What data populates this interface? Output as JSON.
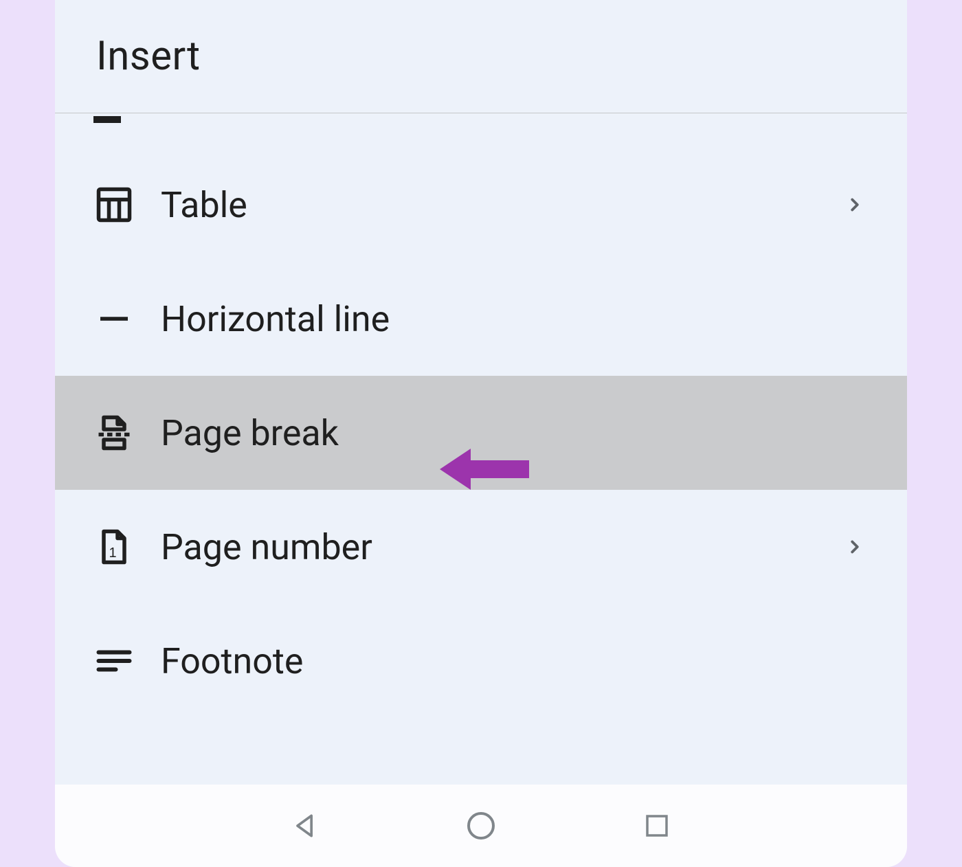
{
  "header": {
    "title": "Insert"
  },
  "menu": {
    "items": [
      {
        "label": "Table",
        "icon": "table-icon",
        "has_submenu": true,
        "highlighted": false
      },
      {
        "label": "Horizontal line",
        "icon": "horizontal-line-icon",
        "has_submenu": false,
        "highlighted": false
      },
      {
        "label": "Page break",
        "icon": "page-break-icon",
        "has_submenu": false,
        "highlighted": true
      },
      {
        "label": "Page number",
        "icon": "page-number-icon",
        "has_submenu": true,
        "highlighted": false
      },
      {
        "label": "Footnote",
        "icon": "footnote-icon",
        "has_submenu": false,
        "highlighted": false
      }
    ]
  },
  "annotation": {
    "color": "#9c27b0"
  }
}
